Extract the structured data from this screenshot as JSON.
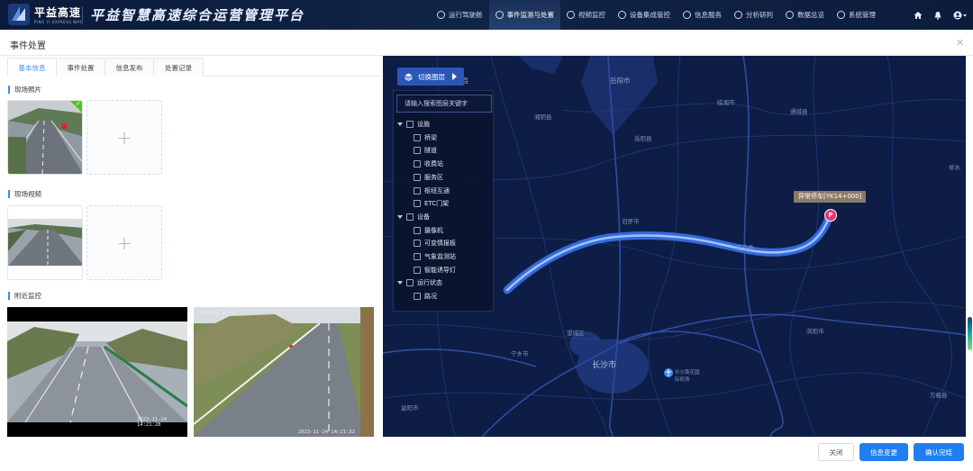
{
  "header": {
    "logo_name": "平益高速",
    "logo_sub": "PING YI EXPRESS WAY",
    "platform_title": "平益智慧高速综合运营管理平台",
    "nav": [
      {
        "label": "运行驾驶舱",
        "icon": "dashboard-icon",
        "active": false
      },
      {
        "label": "事件监测与处置",
        "icon": "leaf-icon",
        "active": true
      },
      {
        "label": "视频监控",
        "icon": "camera-icon",
        "active": false
      },
      {
        "label": "设备集成管控",
        "icon": "devices-icon",
        "active": false
      },
      {
        "label": "信息服务",
        "icon": "info-icon",
        "active": false
      },
      {
        "label": "分析研判",
        "icon": "analysis-icon",
        "active": false
      },
      {
        "label": "数据总览",
        "icon": "data-icon",
        "active": false
      },
      {
        "label": "系统管理",
        "icon": "gear-icon",
        "active": false
      }
    ]
  },
  "dialog": {
    "title": "事件处置",
    "close_icon": "close-icon"
  },
  "tabs": [
    "基本信息",
    "事件处置",
    "信息发布",
    "处置记录"
  ],
  "active_tab": 0,
  "sections": {
    "photos": "现场照片",
    "videos": "现场视频",
    "monitors": "附近监控"
  },
  "monitors": {
    "cam1_ts": "2023-11-24 14:21:28",
    "cam2_ts": "2023-11-24 14:21:32",
    "cam2_overlay": "K14+000 吴仔坳"
  },
  "map": {
    "layer_button": "切换图层",
    "search_placeholder": "请输入搜索图层关键字",
    "tree": [
      {
        "label": "设施",
        "level": 0
      },
      {
        "label": "桥梁",
        "level": 1
      },
      {
        "label": "隧道",
        "level": 1
      },
      {
        "label": "收费站",
        "level": 1
      },
      {
        "label": "服务区",
        "level": 1
      },
      {
        "label": "枢纽互通",
        "level": 1
      },
      {
        "label": "ETC门架",
        "level": 1
      },
      {
        "label": "设备",
        "level": 0
      },
      {
        "label": "摄像机",
        "level": 1
      },
      {
        "label": "可变情报板",
        "level": 1
      },
      {
        "label": "气象监测站",
        "level": 1
      },
      {
        "label": "智能诱导灯",
        "level": 1
      },
      {
        "label": "运行状态",
        "level": 0
      },
      {
        "label": "路况",
        "level": 1
      }
    ],
    "event_tag": "异常停车[YK14+000]",
    "event_pin": "P",
    "labels": {
      "l01": "南县",
      "l02": "岳阳市",
      "l03": "湘阴县",
      "l04": "通城县",
      "l05": "平江县",
      "l06": "长沙市",
      "l07": "望城区",
      "l08": "宁乡市",
      "l09": "汨罗市",
      "l10": "浏阳市",
      "l11": "万载县",
      "l12": "修水",
      "l13": "岳阳县",
      "l14": "长沙黄花国际机场",
      "l15": "临湘市",
      "l16": "益阳市"
    }
  },
  "footer": {
    "close": "关闭",
    "info_change": "信息变更",
    "confirm": "确认完结"
  },
  "colors": {
    "primary": "#1e7ff0",
    "map_bg": "#0e1d46",
    "route": "#6aa6ff",
    "event": "#e6337a"
  }
}
